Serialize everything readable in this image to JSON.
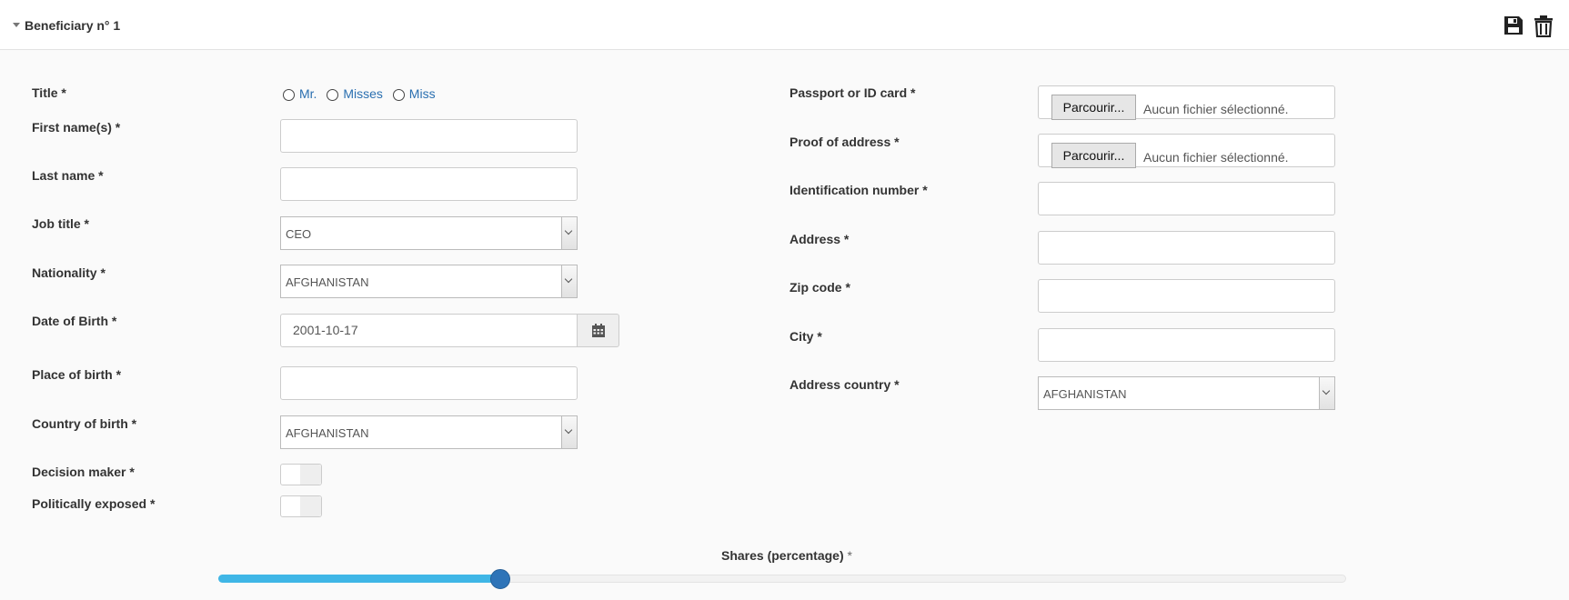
{
  "header": {
    "title": "Beneficiary n° 1"
  },
  "left": {
    "title_label": "Title *",
    "title_options": [
      "Mr.",
      "Misses",
      "Miss"
    ],
    "first_name_label": "First name(s) *",
    "last_name_label": "Last name *",
    "job_title_label": "Job title *",
    "job_title_value": "CEO",
    "nationality_label": "Nationality *",
    "nationality_value": "AFGHANISTAN",
    "dob_label": "Date of Birth *",
    "dob_value": "2001-10-17",
    "pob_label": "Place of birth *",
    "cob_label": "Country of birth *",
    "cob_value": "AFGHANISTAN",
    "decision_maker_label": "Decision maker *",
    "politically_exposed_label": "Politically exposed *"
  },
  "right": {
    "passport_label": "Passport or ID card *",
    "proof_label": "Proof of address *",
    "browse_label": "Parcourir...",
    "no_file_label": "Aucun fichier sélectionné.",
    "id_number_label": "Identification number *",
    "address_label": "Address *",
    "zip_label": "Zip code *",
    "city_label": "City *",
    "address_country_label": "Address country *",
    "address_country_value": "AFGHANISTAN"
  },
  "shares": {
    "label": "Shares (percentage)",
    "required_mark": "*",
    "value_fraction": 0.25
  },
  "icons": {
    "save": "save-icon",
    "delete": "trash-icon",
    "calendar": "calendar-icon",
    "collapse": "caret-down-icon"
  }
}
